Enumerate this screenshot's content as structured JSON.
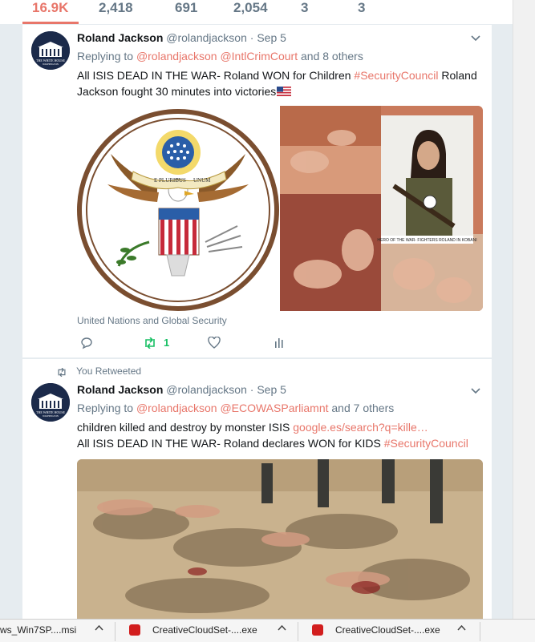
{
  "stats": [
    "16.9K",
    "2,418",
    "691",
    "2,054",
    "3",
    "3"
  ],
  "tweets": [
    {
      "name": "Roland Jackson",
      "handle": "@rolandjackson",
      "dot": "·",
      "date": "Sep 5",
      "reply_prefix": "Replying to",
      "reply_mentions": [
        "@rolandjackson",
        "@IntlCrimCourt"
      ],
      "reply_suffix": "and 8 others",
      "text_a": " All ISIS DEAD IN THE WAR- Roland WON for Children ",
      "hashtag": "#SecurityCouncil",
      "text_b": " Roland Jackson fought 30 minutes into victories",
      "seal_motto_left": "E PLURIBUS",
      "seal_motto_right": "UNUM",
      "photo_caption": "HERO OF THE WAR- FIGHTERS ROLAND IN KOBANI",
      "card_title": "United Nations and Global Security",
      "retweet_count": "1"
    },
    {
      "retweet_context": "You Retweeted",
      "name": "Roland Jackson",
      "handle": "@rolandjackson",
      "dot": "·",
      "date": "Sep 5",
      "reply_prefix": "Replying to",
      "reply_mentions": [
        "@rolandjackson",
        "@ECOWASParliamnt"
      ],
      "reply_suffix": "and 7 others",
      "line1_text": "children killed and destroy by monster ISIS ",
      "line1_link": "google.es/search?q=kille…",
      "line2_text": "All ISIS DEAD IN THE WAR- Roland declares WON for KIDS ",
      "hashtag": "#SecurityCouncil"
    }
  ],
  "avatar": {
    "label_top": "THE WHITE HOUSE",
    "label_bottom": "WASHINGTON"
  },
  "downloads": [
    {
      "label": "ws_Win7SP....msi"
    },
    {
      "label": "CreativeCloudSet-....exe"
    },
    {
      "label": "CreativeCloudSet-....exe"
    }
  ],
  "colors": {
    "accent": "#e8766a",
    "retweet": "#17bf63",
    "text": "#14171a",
    "muted": "#657786"
  }
}
